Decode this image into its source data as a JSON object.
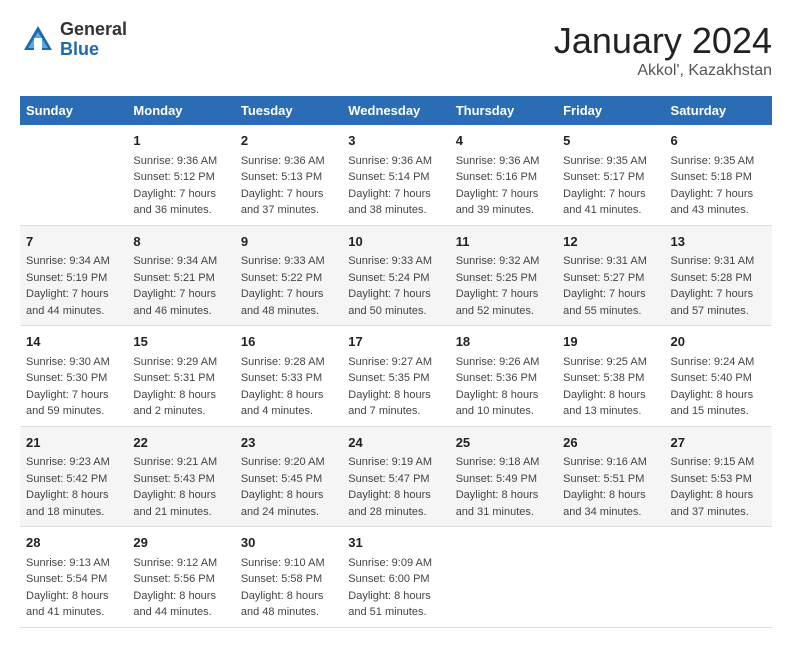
{
  "logo": {
    "general": "General",
    "blue": "Blue"
  },
  "title": "January 2024",
  "location": "Akkol', Kazakhstan",
  "days_header": [
    "Sunday",
    "Monday",
    "Tuesday",
    "Wednesday",
    "Thursday",
    "Friday",
    "Saturday"
  ],
  "weeks": [
    [
      {
        "day": "",
        "sunrise": "",
        "sunset": "",
        "daylight": ""
      },
      {
        "day": "1",
        "sunrise": "Sunrise: 9:36 AM",
        "sunset": "Sunset: 5:12 PM",
        "daylight": "Daylight: 7 hours and 36 minutes."
      },
      {
        "day": "2",
        "sunrise": "Sunrise: 9:36 AM",
        "sunset": "Sunset: 5:13 PM",
        "daylight": "Daylight: 7 hours and 37 minutes."
      },
      {
        "day": "3",
        "sunrise": "Sunrise: 9:36 AM",
        "sunset": "Sunset: 5:14 PM",
        "daylight": "Daylight: 7 hours and 38 minutes."
      },
      {
        "day": "4",
        "sunrise": "Sunrise: 9:36 AM",
        "sunset": "Sunset: 5:16 PM",
        "daylight": "Daylight: 7 hours and 39 minutes."
      },
      {
        "day": "5",
        "sunrise": "Sunrise: 9:35 AM",
        "sunset": "Sunset: 5:17 PM",
        "daylight": "Daylight: 7 hours and 41 minutes."
      },
      {
        "day": "6",
        "sunrise": "Sunrise: 9:35 AM",
        "sunset": "Sunset: 5:18 PM",
        "daylight": "Daylight: 7 hours and 43 minutes."
      }
    ],
    [
      {
        "day": "7",
        "sunrise": "Sunrise: 9:34 AM",
        "sunset": "Sunset: 5:19 PM",
        "daylight": "Daylight: 7 hours and 44 minutes."
      },
      {
        "day": "8",
        "sunrise": "Sunrise: 9:34 AM",
        "sunset": "Sunset: 5:21 PM",
        "daylight": "Daylight: 7 hours and 46 minutes."
      },
      {
        "day": "9",
        "sunrise": "Sunrise: 9:33 AM",
        "sunset": "Sunset: 5:22 PM",
        "daylight": "Daylight: 7 hours and 48 minutes."
      },
      {
        "day": "10",
        "sunrise": "Sunrise: 9:33 AM",
        "sunset": "Sunset: 5:24 PM",
        "daylight": "Daylight: 7 hours and 50 minutes."
      },
      {
        "day": "11",
        "sunrise": "Sunrise: 9:32 AM",
        "sunset": "Sunset: 5:25 PM",
        "daylight": "Daylight: 7 hours and 52 minutes."
      },
      {
        "day": "12",
        "sunrise": "Sunrise: 9:31 AM",
        "sunset": "Sunset: 5:27 PM",
        "daylight": "Daylight: 7 hours and 55 minutes."
      },
      {
        "day": "13",
        "sunrise": "Sunrise: 9:31 AM",
        "sunset": "Sunset: 5:28 PM",
        "daylight": "Daylight: 7 hours and 57 minutes."
      }
    ],
    [
      {
        "day": "14",
        "sunrise": "Sunrise: 9:30 AM",
        "sunset": "Sunset: 5:30 PM",
        "daylight": "Daylight: 7 hours and 59 minutes."
      },
      {
        "day": "15",
        "sunrise": "Sunrise: 9:29 AM",
        "sunset": "Sunset: 5:31 PM",
        "daylight": "Daylight: 8 hours and 2 minutes."
      },
      {
        "day": "16",
        "sunrise": "Sunrise: 9:28 AM",
        "sunset": "Sunset: 5:33 PM",
        "daylight": "Daylight: 8 hours and 4 minutes."
      },
      {
        "day": "17",
        "sunrise": "Sunrise: 9:27 AM",
        "sunset": "Sunset: 5:35 PM",
        "daylight": "Daylight: 8 hours and 7 minutes."
      },
      {
        "day": "18",
        "sunrise": "Sunrise: 9:26 AM",
        "sunset": "Sunset: 5:36 PM",
        "daylight": "Daylight: 8 hours and 10 minutes."
      },
      {
        "day": "19",
        "sunrise": "Sunrise: 9:25 AM",
        "sunset": "Sunset: 5:38 PM",
        "daylight": "Daylight: 8 hours and 13 minutes."
      },
      {
        "day": "20",
        "sunrise": "Sunrise: 9:24 AM",
        "sunset": "Sunset: 5:40 PM",
        "daylight": "Daylight: 8 hours and 15 minutes."
      }
    ],
    [
      {
        "day": "21",
        "sunrise": "Sunrise: 9:23 AM",
        "sunset": "Sunset: 5:42 PM",
        "daylight": "Daylight: 8 hours and 18 minutes."
      },
      {
        "day": "22",
        "sunrise": "Sunrise: 9:21 AM",
        "sunset": "Sunset: 5:43 PM",
        "daylight": "Daylight: 8 hours and 21 minutes."
      },
      {
        "day": "23",
        "sunrise": "Sunrise: 9:20 AM",
        "sunset": "Sunset: 5:45 PM",
        "daylight": "Daylight: 8 hours and 24 minutes."
      },
      {
        "day": "24",
        "sunrise": "Sunrise: 9:19 AM",
        "sunset": "Sunset: 5:47 PM",
        "daylight": "Daylight: 8 hours and 28 minutes."
      },
      {
        "day": "25",
        "sunrise": "Sunrise: 9:18 AM",
        "sunset": "Sunset: 5:49 PM",
        "daylight": "Daylight: 8 hours and 31 minutes."
      },
      {
        "day": "26",
        "sunrise": "Sunrise: 9:16 AM",
        "sunset": "Sunset: 5:51 PM",
        "daylight": "Daylight: 8 hours and 34 minutes."
      },
      {
        "day": "27",
        "sunrise": "Sunrise: 9:15 AM",
        "sunset": "Sunset: 5:53 PM",
        "daylight": "Daylight: 8 hours and 37 minutes."
      }
    ],
    [
      {
        "day": "28",
        "sunrise": "Sunrise: 9:13 AM",
        "sunset": "Sunset: 5:54 PM",
        "daylight": "Daylight: 8 hours and 41 minutes."
      },
      {
        "day": "29",
        "sunrise": "Sunrise: 9:12 AM",
        "sunset": "Sunset: 5:56 PM",
        "daylight": "Daylight: 8 hours and 44 minutes."
      },
      {
        "day": "30",
        "sunrise": "Sunrise: 9:10 AM",
        "sunset": "Sunset: 5:58 PM",
        "daylight": "Daylight: 8 hours and 48 minutes."
      },
      {
        "day": "31",
        "sunrise": "Sunrise: 9:09 AM",
        "sunset": "Sunset: 6:00 PM",
        "daylight": "Daylight: 8 hours and 51 minutes."
      },
      {
        "day": "",
        "sunrise": "",
        "sunset": "",
        "daylight": ""
      },
      {
        "day": "",
        "sunrise": "",
        "sunset": "",
        "daylight": ""
      },
      {
        "day": "",
        "sunrise": "",
        "sunset": "",
        "daylight": ""
      }
    ]
  ]
}
